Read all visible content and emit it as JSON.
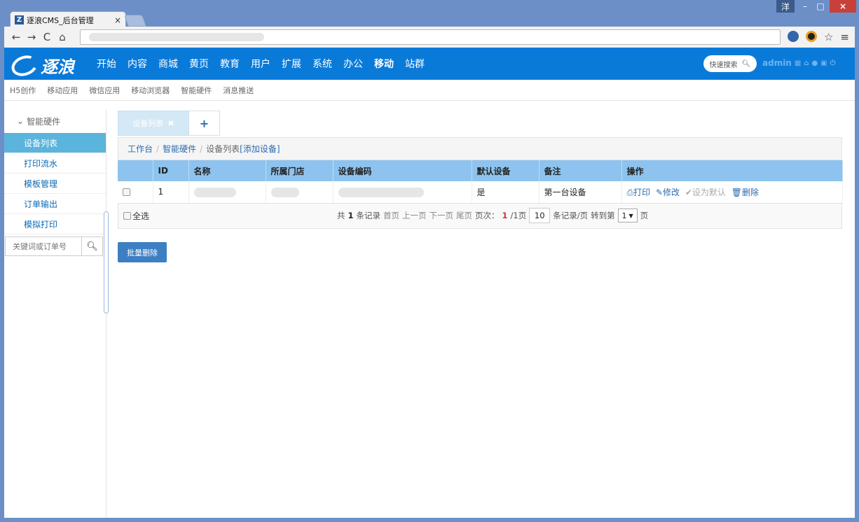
{
  "browser": {
    "tab_title": "逐浪CMS_后台管理",
    "tab_favicon": "Z",
    "tab_close": "×",
    "win_user": "洋",
    "win_min": "–",
    "win_max": "□",
    "win_close": "×",
    "back": "←",
    "forward": "→",
    "reload": "C",
    "home": "⌂",
    "star": "☆",
    "menu": "≡"
  },
  "header": {
    "logo_text": "逐浪",
    "menu": [
      "开始",
      "内容",
      "商城",
      "黄页",
      "教育",
      "用户",
      "扩展",
      "系统",
      "办公",
      "移动",
      "站群"
    ],
    "active_menu": "移动",
    "quick_search": "快速搜索",
    "admin": "admin"
  },
  "subnav": [
    "H5创作",
    "移动应用",
    "微信应用",
    "移动浏览器",
    "智能硬件",
    "消息推送"
  ],
  "sidebar": {
    "group": "智能硬件",
    "items": [
      "设备列表",
      "打印流水",
      "模板管理",
      "订单输出",
      "模拟打印"
    ],
    "search_placeholder": "关键词或订单号"
  },
  "tabs": {
    "active": "设备列表",
    "close": "✖",
    "add": "+"
  },
  "breadcrumb": {
    "home": "工作台",
    "section": "智能硬件",
    "current": "设备列表",
    "action": "[添加设备]"
  },
  "table": {
    "headers": [
      "",
      "ID",
      "名称",
      "所属门店",
      "设备编码",
      "默认设备",
      "备注",
      "操作"
    ],
    "rows": [
      {
        "id": "1",
        "name": "",
        "store": "",
        "code": "",
        "default": "是",
        "note": "第一台设备"
      }
    ],
    "actions": {
      "print": "打印",
      "edit": "修改",
      "set_default": "设为默认",
      "delete": "删除"
    }
  },
  "pager": {
    "select_all": "全选",
    "total_prefix": "共",
    "total": "1",
    "total_suffix": "条记录",
    "first": "首页",
    "prev": "上一页",
    "next": "下一页",
    "last": "尾页",
    "page_label": "页次：",
    "page_current": "1",
    "page_total": "/1页",
    "page_size": "10",
    "page_size_suffix": "条记录/页",
    "goto_prefix": "转到第",
    "goto_value": "1",
    "goto_suffix": "页"
  },
  "batch_delete": "批量删除"
}
